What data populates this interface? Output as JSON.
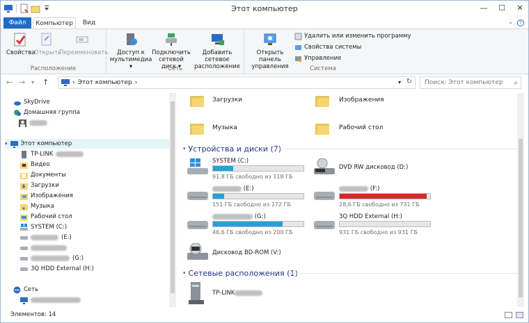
{
  "window": {
    "title": "Этот компьютер"
  },
  "window_controls": {
    "minimize": "—",
    "maximize": "☐",
    "close": "✕"
  },
  "tabs": [
    {
      "label": "Файл"
    },
    {
      "label": "Компьютер"
    },
    {
      "label": "Вид"
    }
  ],
  "ribbon": {
    "location": {
      "label": "Расположение",
      "buttons": [
        {
          "label": "Свойства"
        },
        {
          "label": "Открыть"
        },
        {
          "label": "Переименовать"
        }
      ]
    },
    "network": {
      "label": "Сеть",
      "buttons": [
        {
          "label": "Доступ к мультимедиа"
        },
        {
          "label": "Подключить сетевой диск"
        },
        {
          "label": "Добавить сетевое расположение"
        }
      ]
    },
    "system": {
      "label": "Система",
      "open_panel": "Открыть панель управления",
      "items": [
        {
          "label": "Удалить или изменить программу"
        },
        {
          "label": "Свойства системы"
        },
        {
          "label": "Управление"
        }
      ]
    }
  },
  "address": {
    "path": "Этот компьютер",
    "search_placeholder": "Поиск: Этот компьютер"
  },
  "nav": {
    "items": [
      {
        "label": "SkyDrive"
      },
      {
        "label": "Домашняя группа"
      },
      {
        "label": "Этот компьютер"
      },
      {
        "label": "TP-LINK"
      },
      {
        "label": "Видео"
      },
      {
        "label": "Документы"
      },
      {
        "label": "Загрузки"
      },
      {
        "label": "Изображения"
      },
      {
        "label": "Музыка"
      },
      {
        "label": "Рабочий стол"
      },
      {
        "label": "SYSTEM (C:)"
      },
      {
        "label": "(E:)"
      },
      {
        "label": "(G:)"
      },
      {
        "label": "3Q HDD External (H:)"
      },
      {
        "label": "Сеть"
      }
    ]
  },
  "folders": [
    {
      "label": "Загрузки"
    },
    {
      "label": "Изображения"
    },
    {
      "label": "Музыка"
    },
    {
      "label": "Рабочий стол"
    }
  ],
  "sections": {
    "devices": "Устройства и диски (7)",
    "network": "Сетевые расположения (1)"
  },
  "drives": [
    {
      "name": "SYSTEM (C:)",
      "free": "91,8 ГБ свободно из 118 ГБ",
      "used_fraction": 0.22
    },
    {
      "name": "DVD RW дисковод (D:)"
    },
    {
      "name": "(E:)",
      "free": "151 ГБ свободно из 172 ГБ",
      "used_fraction": 0.12
    },
    {
      "name": "(F:)",
      "free": "28,6 ГБ свободно из 731 ГБ",
      "used_fraction": 0.96
    },
    {
      "name": "(G:)",
      "free": "46,6 ГБ свободно из 200 ГБ",
      "used_fraction": 0.77
    },
    {
      "name": "3Q HDD External (H:)",
      "free": "931 ГБ свободно из 931 ГБ",
      "used_fraction": 0.0
    },
    {
      "name": "Дисковод BD-ROM (V:)"
    }
  ],
  "network_locations": [
    {
      "name": "TP-LINK"
    }
  ],
  "status": {
    "count": "Элементов: 14"
  },
  "colors": {
    "accent": "#1f6cc6",
    "drive_bar": "#26a0da",
    "drive_bar_full": "#da2626",
    "section_text": "#1e3287"
  }
}
